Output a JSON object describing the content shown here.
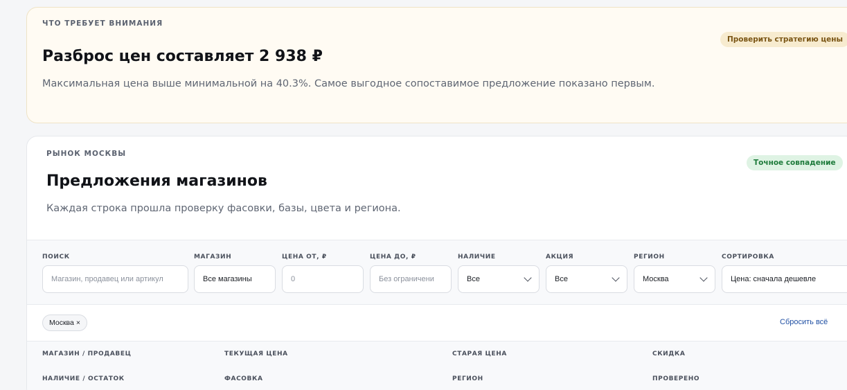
{
  "alert": {
    "eyebrow": "ЧТО ТРЕБУЕТ ВНИМАНИЯ",
    "title": "Разброс цен составляет 2 938 ₽",
    "description": "Максимальная цена выше минимальной на 40.3%. Самое выгодное сопоставимое предложение показано первым.",
    "action_label": "Проверить стратегию цены"
  },
  "offers": {
    "eyebrow": "РЫНОК МОСКВЫ",
    "title": "Предложения магазинов",
    "description": "Каждая строка прошла проверку фасовки, базы, цвета и региона.",
    "badge": "Точное совпадение"
  },
  "filters": {
    "search": {
      "label": "ПОИСК",
      "placeholder": "Магазин, продавец или артикул"
    },
    "store": {
      "label": "МАГАЗИН",
      "value": "Все магазины"
    },
    "price_from": {
      "label": "ЦЕНА ОТ, ₽",
      "placeholder": "0"
    },
    "price_to": {
      "label": "ЦЕНА ДО, ₽",
      "placeholder": "Без ограничени"
    },
    "availability": {
      "label": "НАЛИЧИЕ",
      "value": "Все"
    },
    "promo": {
      "label": "АКЦИЯ",
      "value": "Все"
    },
    "region": {
      "label": "РЕГИОН",
      "value": "Москва"
    },
    "sort": {
      "label": "СОРТИРОВКА",
      "value": "Цена: сначала дешевле"
    }
  },
  "active_chips": [
    {
      "label": "Москва",
      "remove": "×"
    }
  ],
  "reset_label": "Сбросить всё",
  "table": {
    "columns_row1": [
      "МАГАЗИН / ПРОДАВЕЦ",
      "ТЕКУЩАЯ ЦЕНА",
      "СТАРАЯ ЦЕНА",
      "СКИДКА"
    ],
    "columns_row2": [
      "НАЛИЧИЕ / ОСТАТОК",
      "ФАСОВКА",
      "РЕГИОН",
      "ПРОВЕРЕНО"
    ]
  },
  "colors": {
    "alert_bg": "#fffbf3",
    "amber_pill_bg": "#f7ebcf",
    "green_pill_bg": "#dff3e4",
    "link": "#1f4fa3"
  }
}
